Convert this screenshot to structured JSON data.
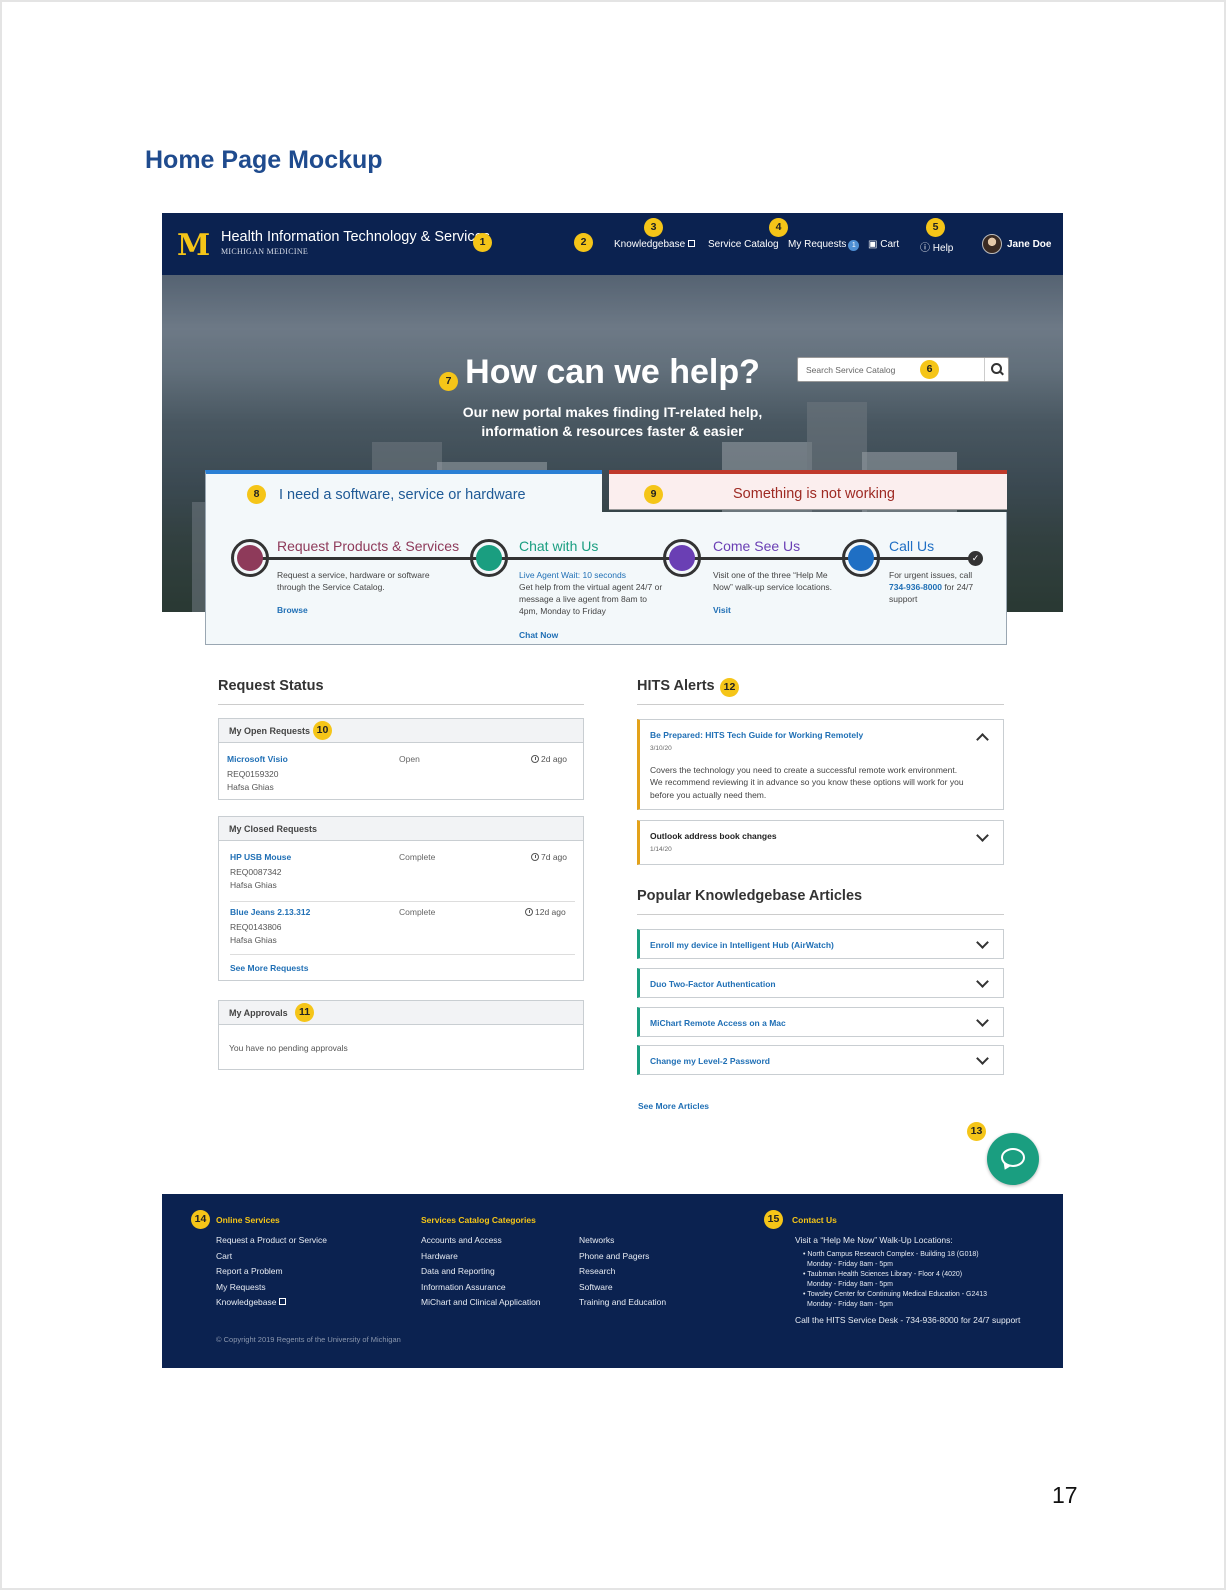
{
  "document": {
    "title": "Home Page Mockup",
    "page_number": "17"
  },
  "header": {
    "logo_mark": "M",
    "logo_title": "Health Information Technology & Services",
    "logo_subtitle": "MICHIGAN MEDICINE",
    "nav": {
      "knowledgebase": "Knowledgebase",
      "service_catalog": "Service Catalog",
      "my_requests": "My Requests",
      "my_requests_count": "1",
      "cart": "Cart",
      "help": "Help",
      "user": "Jane Doe"
    }
  },
  "callouts": [
    "1",
    "2",
    "3",
    "4",
    "5",
    "6",
    "7",
    "8",
    "9",
    "10",
    "11",
    "12",
    "13",
    "14",
    "15"
  ],
  "hero": {
    "search_placeholder": "Search Service Catalog",
    "title": "How can we help?",
    "subtitle": "Our new portal makes finding IT-related help, information & resources faster & easier"
  },
  "tabs": {
    "need": "I need a software, service or hardware",
    "broken": "Something is not working"
  },
  "services": [
    {
      "title": "Request Products & Services",
      "desc": "Request a service, hardware or software through the Service Catalog.",
      "action": "Browse",
      "color": "#8e3a5a"
    },
    {
      "title": "Chat with Us",
      "wait": "Live Agent Wait: 10 seconds",
      "desc": "Get help from the virtual agent 24/7 or message a live agent from 8am to 4pm, Monday to Friday",
      "action": "Chat Now",
      "color": "#1a9e80"
    },
    {
      "title": "Come See Us",
      "desc": "Visit one of the three “Help Me Now” walk-up service locations.",
      "action": "Visit",
      "color": "#6a3fb4"
    },
    {
      "title": "Call Us",
      "desc_pre": "For urgent issues, call",
      "phone": "734-936-8000",
      "desc_post": "for 24/7 support",
      "color": "#1f6fc4"
    }
  ],
  "request_status": {
    "heading": "Request Status",
    "open": {
      "heading": "My Open Requests",
      "items": [
        {
          "name": "Microsoft Visio",
          "id": "REQ0159320",
          "person": "Hafsa Ghias",
          "status": "Open",
          "age": "2d ago"
        }
      ]
    },
    "closed": {
      "heading": "My Closed Requests",
      "items": [
        {
          "name": "HP USB Mouse",
          "id": "REQ0087342",
          "person": "Hafsa Ghias",
          "status": "Complete",
          "age": "7d ago"
        },
        {
          "name": "Blue Jeans 2.13.312",
          "id": "REQ0143806",
          "person": "Hafsa Ghias",
          "status": "Complete",
          "age": "12d ago"
        }
      ],
      "see_more": "See More Requests"
    },
    "approvals": {
      "heading": "My Approvals",
      "empty": "You have no pending approvals"
    }
  },
  "alerts": {
    "heading": "HITS Alerts",
    "items": [
      {
        "title": "Be Prepared: HITS Tech Guide for Working Remotely",
        "date": "3/10/20",
        "body": "Covers the technology you need to create a successful remote work environment. We recommend reviewing it in advance so you know these options will work for you before you actually need them."
      },
      {
        "title": "Outlook address book changes",
        "date": "1/14/20"
      }
    ]
  },
  "kb": {
    "heading": "Popular Knowledgebase Articles",
    "items": [
      "Enroll my device in Intelligent Hub (AirWatch)",
      "Duo Two-Factor Authentication",
      "MiChart Remote Access on a Mac",
      "Change my Level-2 Password"
    ],
    "see_more": "See More Articles"
  },
  "footer": {
    "online": {
      "heading": "Online Services",
      "links": [
        "Request a Product or Service",
        "Cart",
        "Report a Problem",
        "My Requests",
        "Knowledgebase"
      ]
    },
    "catalog": {
      "heading": "Services Catalog Categories",
      "col1": [
        "Accounts and Access",
        "Hardware",
        "Data and Reporting",
        "Information Assurance",
        "MiChart and Clinical Application"
      ],
      "col2": [
        "Networks",
        "Phone and Pagers",
        "Research",
        "Software",
        "Training and Education"
      ]
    },
    "contact": {
      "heading": "Contact Us",
      "intro": "Visit a  “Help Me Now” Walk-Up Locations:",
      "locations": [
        {
          "name": "• North Campus Research Complex - Building 18 (G018)",
          "hours": "Monday - Friday 8am - 5pm"
        },
        {
          "name": "• Taubman Health Sciences Library - Floor 4 (4020)",
          "hours": "Monday - Friday 8am - 5pm"
        },
        {
          "name": "• Towsley Center for Continuing Medical Education - G2413",
          "hours": "Monday - Friday 8am - 5pm"
        }
      ],
      "call": "Call the HITS Service Desk - 734-936-8000  for 24/7 support"
    },
    "copyright": "© Copyright 2019 Regents of the University of Michigan"
  }
}
